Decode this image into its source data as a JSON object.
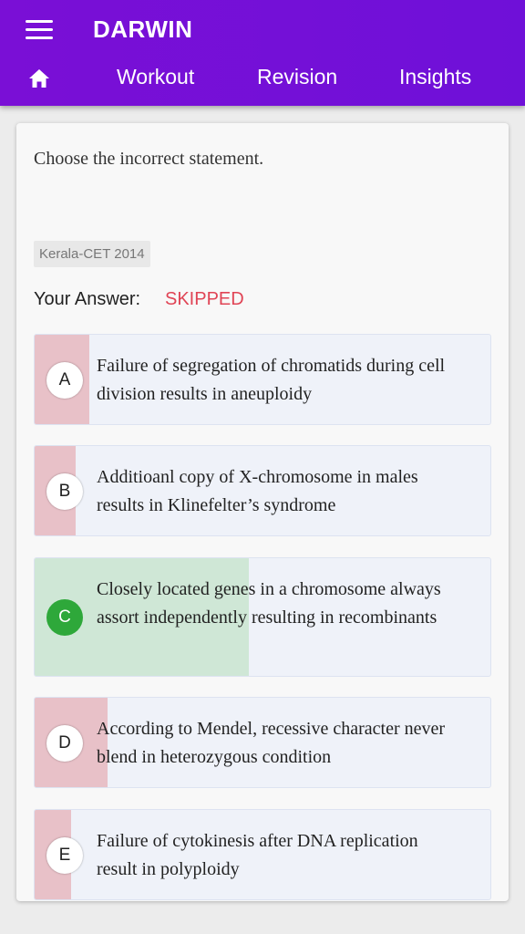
{
  "appbar": {
    "title": "DARWIN",
    "nav": [
      "Workout",
      "Revision",
      "Insights"
    ]
  },
  "question": {
    "text": "Choose the incorrect statement.",
    "exam_tag": "Kerala-CET 2014",
    "answer_label": "Your Answer:",
    "answer_value": "SKIPPED"
  },
  "options": [
    {
      "letter": "A",
      "text": "Failure of segregation of chromatids during cell division results in aneuploidy",
      "percent": 12,
      "correct": false
    },
    {
      "letter": "B",
      "text": "Additioanl copy of X-chromosome in males results in Klinefelter’s syndrome",
      "percent": 9,
      "correct": false
    },
    {
      "letter": "C",
      "text": "Closely located genes in a chromosome always assort independently resulting in recombinants",
      "percent": 47,
      "correct": true
    },
    {
      "letter": "D",
      "text": "According to Mendel, recessive character never blend in heterozygous condition",
      "percent": 16,
      "correct": false
    },
    {
      "letter": "E",
      "text": "Failure of cytokinesis after DNA replication result in polyploidy",
      "percent": 8,
      "correct": false
    }
  ],
  "colors": {
    "appbar": "#7a0fd6",
    "wrong_fill": "#e8c1c8",
    "correct_fill": "#cfe7d6",
    "correct_badge": "#2ea83a",
    "skipped": "#e04455"
  }
}
